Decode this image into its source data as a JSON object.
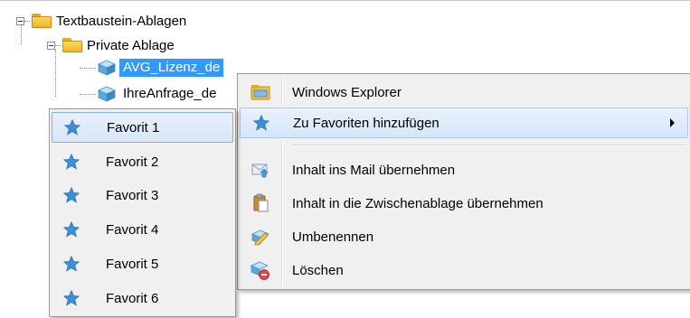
{
  "tree": {
    "root_label": "Textbaustein-Ablagen",
    "child_label": "Private Ablage",
    "leaves": [
      {
        "label": "AVG_Lizenz_de",
        "selected": true
      },
      {
        "label": "IhreAnfrage_de",
        "selected": false
      }
    ]
  },
  "context_menu": {
    "items": [
      {
        "label": "Windows Explorer",
        "icon": "explorer-folder-icon"
      },
      {
        "label": "Zu Favoriten hinzufügen",
        "icon": "star-icon",
        "highlighted": true,
        "has_submenu": true
      },
      {
        "label": "Inhalt ins Mail übernehmen",
        "icon": "mail-arrow-icon"
      },
      {
        "label": "Inhalt in die Zwischenablage übernehmen",
        "icon": "clipboard-icon"
      },
      {
        "label": "Umbenennen",
        "icon": "rename-pencil-icon"
      },
      {
        "label": "Löschen",
        "icon": "delete-icon"
      }
    ]
  },
  "favorites_submenu": {
    "items": [
      {
        "label": "Favorit 1",
        "highlighted": true
      },
      {
        "label": "Favorit 2"
      },
      {
        "label": "Favorit 3"
      },
      {
        "label": "Favorit 4"
      },
      {
        "label": "Favorit 5"
      },
      {
        "label": "Favorit 6"
      }
    ]
  },
  "colors": {
    "selection": "#3399ff",
    "menu_background": "#f0f0f0",
    "star": "#3a8fd8"
  }
}
